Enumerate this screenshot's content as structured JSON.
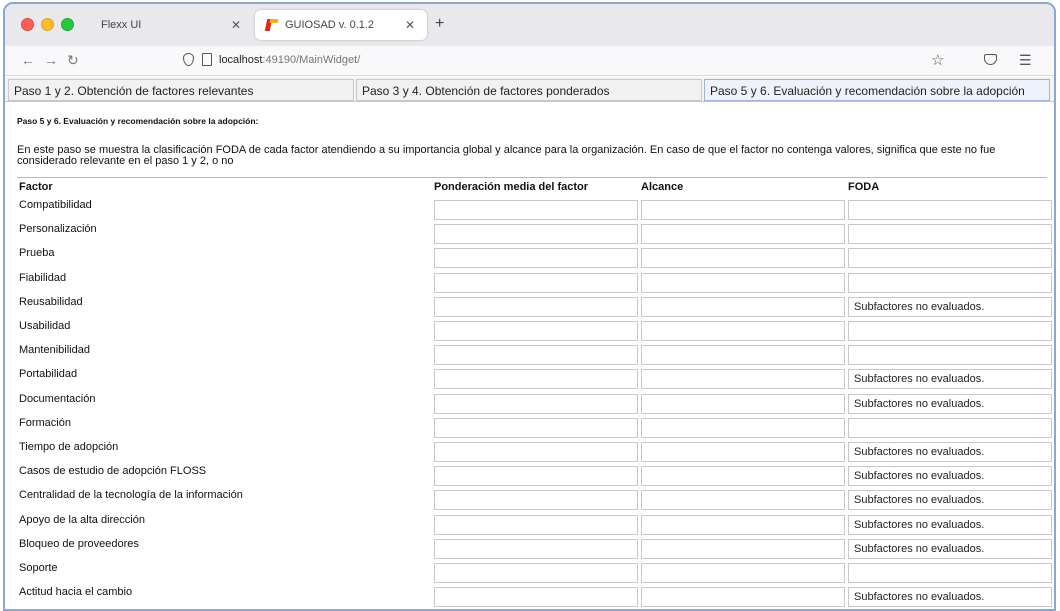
{
  "browser": {
    "tabs": [
      {
        "label": "Flexx UI",
        "active": false
      },
      {
        "label": "GUIOSAD v. 0.1.2",
        "active": true
      }
    ],
    "url_host": "localhost",
    "url_rest": ":49190/MainWidget/"
  },
  "app_tabs": [
    {
      "label": "Paso 1 y 2. Obtención de factores relevantes",
      "active": false
    },
    {
      "label": "Paso 3 y 4. Obtención de factores ponderados",
      "active": false
    },
    {
      "label": "Paso 5 y 6. Evaluación y recomendación sobre la adopción",
      "active": true
    }
  ],
  "page": {
    "heading": "Paso 5 y 6. Evaluación y recomendación sobre la adopción:",
    "description": "En este paso se muestra la clasificación FODA de cada factor atendiendo a su importancia global y alcance para la organización. En caso de que el factor no contenga valores, significa que este no fue considerado relevante en el paso 1 y 2, o no"
  },
  "table": {
    "headers": [
      "Factor",
      "Ponderación media del factor",
      "Alcance",
      "FODA"
    ],
    "rows": [
      {
        "factor": "Compatibilidad",
        "ponderacion": "",
        "alcance": "",
        "foda": ""
      },
      {
        "factor": "Personalización",
        "ponderacion": "",
        "alcance": "",
        "foda": ""
      },
      {
        "factor": "Prueba",
        "ponderacion": "",
        "alcance": "",
        "foda": ""
      },
      {
        "factor": "Fiabilidad",
        "ponderacion": "",
        "alcance": "",
        "foda": ""
      },
      {
        "factor": "Reusabilidad",
        "ponderacion": "",
        "alcance": "",
        "foda": "Subfactores no evaluados."
      },
      {
        "factor": "Usabilidad",
        "ponderacion": "",
        "alcance": "",
        "foda": ""
      },
      {
        "factor": "Mantenibilidad",
        "ponderacion": "",
        "alcance": "",
        "foda": ""
      },
      {
        "factor": "Portabilidad",
        "ponderacion": "",
        "alcance": "",
        "foda": "Subfactores no evaluados."
      },
      {
        "factor": "Documentación",
        "ponderacion": "",
        "alcance": "",
        "foda": "Subfactores no evaluados."
      },
      {
        "factor": "Formación",
        "ponderacion": "",
        "alcance": "",
        "foda": ""
      },
      {
        "factor": "Tiempo de adopción",
        "ponderacion": "",
        "alcance": "",
        "foda": "Subfactores no evaluados."
      },
      {
        "factor": "Casos de estudio de adopción FLOSS",
        "ponderacion": "",
        "alcance": "",
        "foda": "Subfactores no evaluados."
      },
      {
        "factor": "Centralidad de la tecnología de la información",
        "ponderacion": "",
        "alcance": "",
        "foda": "Subfactores no evaluados."
      },
      {
        "factor": "Apoyo de la alta dirección",
        "ponderacion": "",
        "alcance": "",
        "foda": "Subfactores no evaluados."
      },
      {
        "factor": "Bloqueo de proveedores",
        "ponderacion": "",
        "alcance": "",
        "foda": "Subfactores no evaluados."
      },
      {
        "factor": "Soporte",
        "ponderacion": "",
        "alcance": "",
        "foda": ""
      },
      {
        "factor": "Actitud hacia el cambio",
        "ponderacion": "",
        "alcance": "",
        "foda": "Subfactores no evaluados."
      }
    ]
  }
}
